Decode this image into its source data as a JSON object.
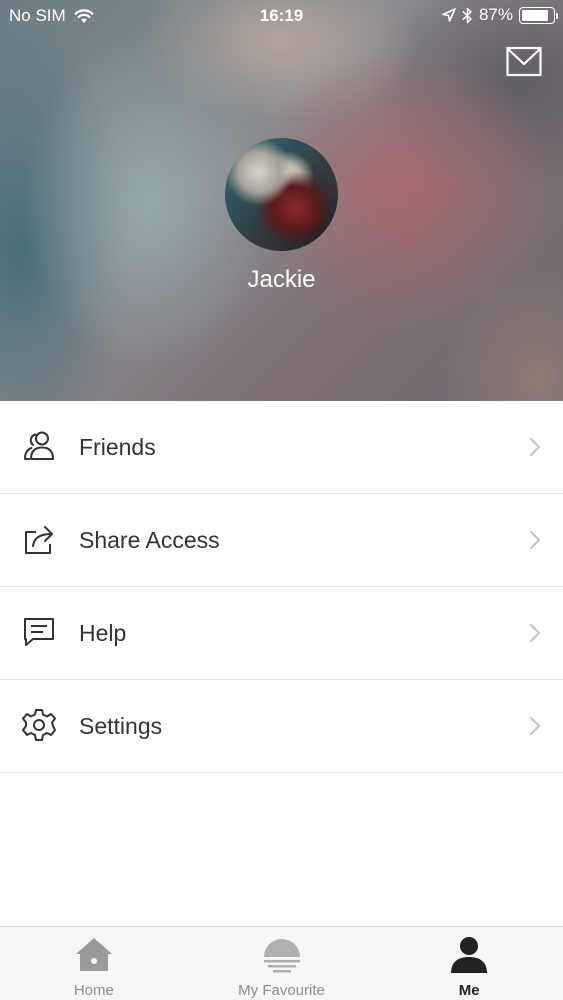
{
  "status_bar": {
    "carrier": "No SIM",
    "time": "16:19",
    "battery_percent": "87%",
    "battery_level": 0.87,
    "icons": [
      "wifi-icon",
      "location-arrow-icon",
      "bluetooth-icon",
      "battery-icon"
    ]
  },
  "header": {
    "mail_icon": "mail-icon",
    "user_name": "Jackie"
  },
  "menu": {
    "items": [
      {
        "label": "Friends",
        "icon": "friends-icon"
      },
      {
        "label": "Share Access",
        "icon": "share-icon"
      },
      {
        "label": "Help",
        "icon": "help-chat-icon"
      },
      {
        "label": "Settings",
        "icon": "gear-icon"
      }
    ]
  },
  "tab_bar": {
    "tabs": [
      {
        "label": "Home",
        "icon": "home-icon",
        "active": false
      },
      {
        "label": "My Favourite",
        "icon": "sunset-icon",
        "active": false
      },
      {
        "label": "Me",
        "icon": "person-icon",
        "active": true
      }
    ]
  },
  "colors": {
    "text_primary": "#333333",
    "tab_inactive": "#8e8e8e",
    "tab_active": "#222222",
    "divider": "#e4e4e4"
  }
}
